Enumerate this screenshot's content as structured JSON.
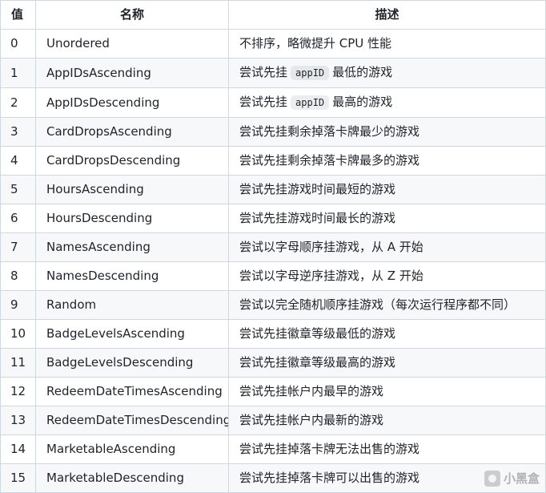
{
  "table": {
    "headers": [
      "值",
      "名称",
      "描述"
    ],
    "rows": [
      {
        "value": "0",
        "name": "Unordered",
        "desc": "不排序，略微提升 CPU 性能"
      },
      {
        "value": "1",
        "name": "AppIDsAscending",
        "desc_pre": "尝试先挂",
        "desc_code": "appID",
        "desc_post": "最低的游戏"
      },
      {
        "value": "2",
        "name": "AppIDsDescending",
        "desc_pre": "尝试先挂",
        "desc_code": "appID",
        "desc_post": "最高的游戏"
      },
      {
        "value": "3",
        "name": "CardDropsAscending",
        "desc": "尝试先挂剩余掉落卡牌最少的游戏"
      },
      {
        "value": "4",
        "name": "CardDropsDescending",
        "desc": "尝试先挂剩余掉落卡牌最多的游戏"
      },
      {
        "value": "5",
        "name": "HoursAscending",
        "desc": "尝试先挂游戏时间最短的游戏"
      },
      {
        "value": "6",
        "name": "HoursDescending",
        "desc": "尝试先挂游戏时间最长的游戏"
      },
      {
        "value": "7",
        "name": "NamesAscending",
        "desc": "尝试以字母顺序挂游戏，从 A 开始"
      },
      {
        "value": "8",
        "name": "NamesDescending",
        "desc": "尝试以字母逆序挂游戏，从 Z 开始"
      },
      {
        "value": "9",
        "name": "Random",
        "desc": "尝试以完全随机顺序挂游戏（每次运行程序都不同）"
      },
      {
        "value": "10",
        "name": "BadgeLevelsAscending",
        "desc": "尝试先挂徽章等级最低的游戏"
      },
      {
        "value": "11",
        "name": "BadgeLevelsDescending",
        "desc": "尝试先挂徽章等级最高的游戏"
      },
      {
        "value": "12",
        "name": "RedeemDateTimesAscending",
        "desc": "尝试先挂帐户内最早的游戏"
      },
      {
        "value": "13",
        "name": "RedeemDateTimesDescending",
        "desc": "尝试先挂帐户内最新的游戏"
      },
      {
        "value": "14",
        "name": "MarketableAscending",
        "desc": "尝试先挂掉落卡牌无法出售的游戏"
      },
      {
        "value": "15",
        "name": "MarketableDescending",
        "desc": "尝试先挂掉落卡牌可以出售的游戏"
      }
    ]
  },
  "watermark": {
    "text": "小黑盒",
    "icon": "xiaoheihe-logo-icon"
  }
}
